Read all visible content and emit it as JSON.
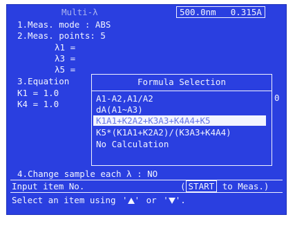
{
  "header": {
    "title": "Multi-λ",
    "wavelength_1": "500.0nm",
    "wavelength_2": "0.315A"
  },
  "menu": {
    "item1": "1.Meas. mode  : ABS",
    "item2": "2.Meas. points: 5",
    "lambda1": "λ1 =",
    "lambda3": "λ3 =",
    "lambda5": "λ5 =",
    "item3": "3.Equation",
    "k1": "K1 =  1.0",
    "k4": "K4 =  1.0",
    "k_trail": "0",
    "item4": "4.Change sample each  λ : NO"
  },
  "popup": {
    "title": "Formula Selection",
    "options": [
      "A1-A2,A1/A2",
      "dA(A1~A3)",
      "K1A1+K2A2+K3A3+K4A4+K5",
      "K5*(K1A1+K2A2)/(K3A3+K4A4)",
      "No Calculation"
    ],
    "selected_index": 2
  },
  "footer": {
    "input_label": "Input item No.",
    "start_key": "START",
    "start_suffix": "to Meas.)",
    "start_prefix": "(",
    "hint_prefix": "Select an item using",
    "hint_or": "or",
    "up_arrow_icon": "up-arrow-icon",
    "down_arrow_icon": "down-arrow-icon"
  }
}
